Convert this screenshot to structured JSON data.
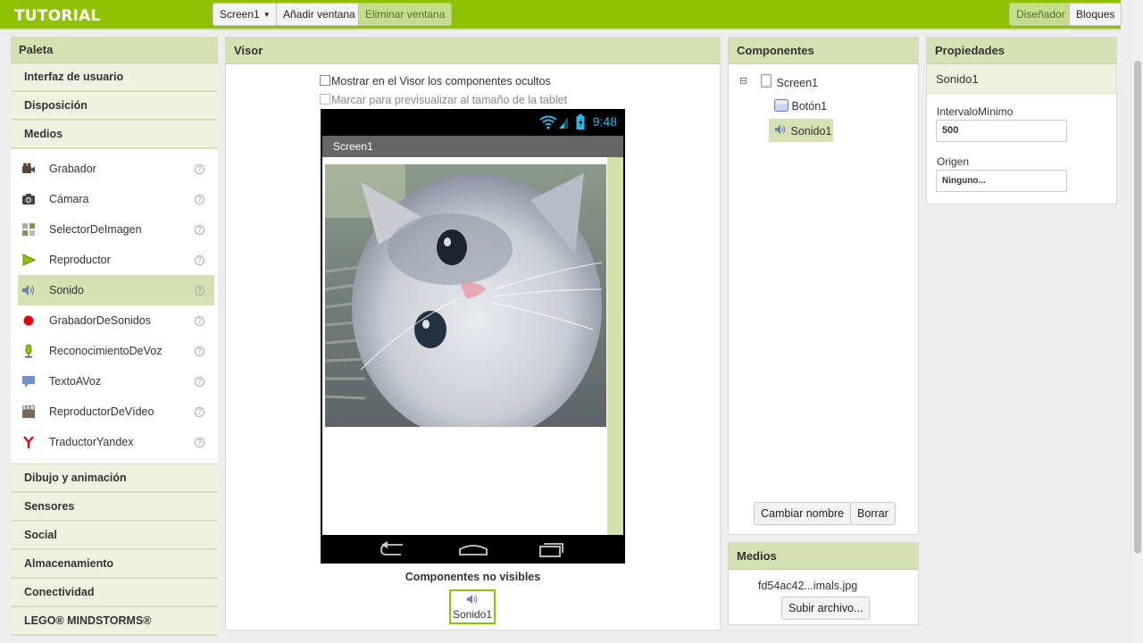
{
  "app": {
    "title": "TUTORIAL"
  },
  "toolbar": {
    "screen_select": "Screen1",
    "add_screen": "Añadir ventana",
    "remove_screen": "Eliminar ventana",
    "designer": "Diseñador",
    "blocks": "Bloques"
  },
  "palette": {
    "title": "Paleta",
    "categories_top": [
      "Interfaz de usuario",
      "Disposición",
      "Medios"
    ],
    "items": [
      {
        "label": "Grabador",
        "icon": "video-camera-icon"
      },
      {
        "label": "Cámara",
        "icon": "camera-icon"
      },
      {
        "label": "SelectorDeImagen",
        "icon": "image-picker-icon"
      },
      {
        "label": "Reproductor",
        "icon": "play-icon"
      },
      {
        "label": "Sonido",
        "icon": "speaker-icon",
        "selected": true
      },
      {
        "label": "GrabadorDeSonidos",
        "icon": "record-dot-icon"
      },
      {
        "label": "ReconocimientoDeVoz",
        "icon": "microphone-icon"
      },
      {
        "label": "TextoAVoz",
        "icon": "speech-bubble-icon"
      },
      {
        "label": "ReproductorDeVídeo",
        "icon": "clapperboard-icon"
      },
      {
        "label": "TraductorYandex",
        "icon": "yandex-icon"
      }
    ],
    "help_glyph": "?",
    "categories_bottom": [
      "Dibujo y animación",
      "Sensores",
      "Social",
      "Almacenamiento",
      "Conectividad",
      "LEGO® MINDSTORMS®"
    ]
  },
  "viewer": {
    "title": "Visor",
    "show_hidden": "Mostrar en el Visor los componentes ocultos",
    "tablet_preview": "Marcar para previsualizar al tamaño de la tablet",
    "status_time": "9:48",
    "screen_title": "Screen1",
    "nonvisible_title": "Componentes no visibles",
    "nonvisible_items": [
      "Sonido1"
    ]
  },
  "components": {
    "title": "Componentes",
    "tree": [
      "Screen1",
      "Botón1",
      "Sonido1"
    ],
    "collapse_glyph": "⊟",
    "rename": "Cambiar nombre",
    "delete": "Borrar"
  },
  "media": {
    "title": "Medios",
    "file": "fd54ac42...imals.jpg",
    "upload": "Subir archivo..."
  },
  "properties": {
    "title": "Propiedades",
    "component": "Sonido1",
    "min_interval_label": "IntervaloMínimo",
    "min_interval_value": "500",
    "source_label": "Origen",
    "source_value": "Ninguno..."
  },
  "colors": {
    "brand_green": "#8fc202",
    "header_green": "#d4e1b2",
    "status_blue": "#33b5e5"
  }
}
